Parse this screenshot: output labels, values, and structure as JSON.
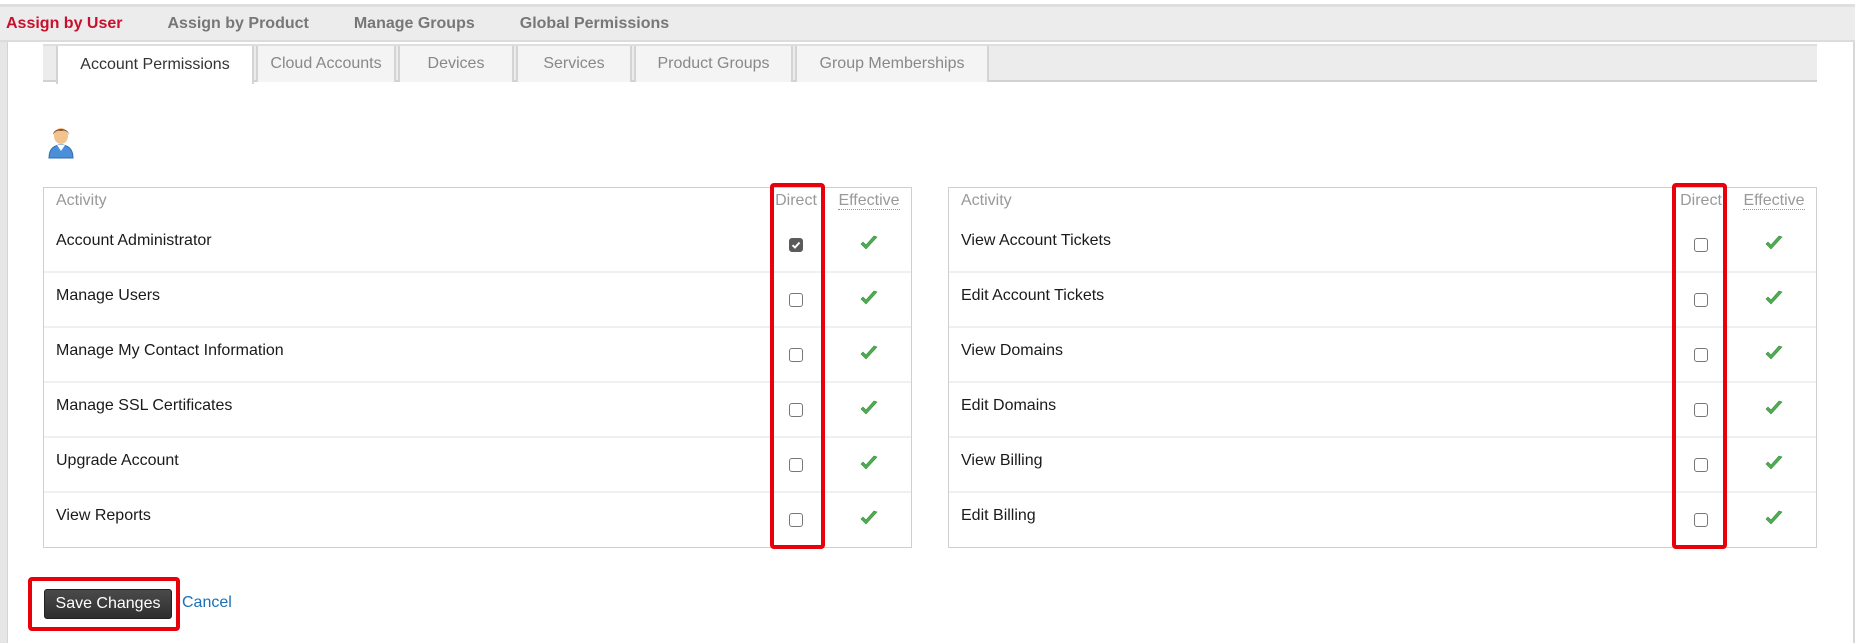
{
  "top_nav": {
    "tabs": [
      {
        "label": "Assign by User",
        "active": true
      },
      {
        "label": "Assign by Product",
        "active": false
      },
      {
        "label": "Manage Groups",
        "active": false
      },
      {
        "label": "Global Permissions",
        "active": false
      }
    ]
  },
  "sub_tabs": [
    {
      "label": "Account Permissions",
      "active": true
    },
    {
      "label": "Cloud Accounts",
      "active": false
    },
    {
      "label": "Devices",
      "active": false
    },
    {
      "label": "Services",
      "active": false
    },
    {
      "label": "Product Groups",
      "active": false
    },
    {
      "label": "Group Memberships",
      "active": false
    }
  ],
  "user": {
    "icon": "user-avatar-icon"
  },
  "tables": {
    "headers": {
      "activity": "Activity",
      "direct": "Direct",
      "effective": "Effective"
    },
    "left": [
      {
        "activity": "Account Administrator",
        "direct": true,
        "effective": true
      },
      {
        "activity": "Manage Users",
        "direct": false,
        "effective": true
      },
      {
        "activity": "Manage My Contact Information",
        "direct": false,
        "effective": true
      },
      {
        "activity": "Manage SSL Certificates",
        "direct": false,
        "effective": true
      },
      {
        "activity": "Upgrade Account",
        "direct": false,
        "effective": true
      },
      {
        "activity": "View Reports",
        "direct": false,
        "effective": true
      }
    ],
    "right": [
      {
        "activity": "View Account Tickets",
        "direct": false,
        "effective": true
      },
      {
        "activity": "Edit Account Tickets",
        "direct": false,
        "effective": true
      },
      {
        "activity": "View Domains",
        "direct": false,
        "effective": true
      },
      {
        "activity": "Edit Domains",
        "direct": false,
        "effective": true
      },
      {
        "activity": "View Billing",
        "direct": false,
        "effective": true
      },
      {
        "activity": "Edit Billing",
        "direct": false,
        "effective": true
      }
    ]
  },
  "actions": {
    "save_label": "Save Changes",
    "cancel_label": "Cancel"
  },
  "colors": {
    "accent_red": "#c8102e",
    "highlight_red": "#e8000b",
    "check_green": "#4caf50",
    "link_blue": "#1a6fb5"
  }
}
